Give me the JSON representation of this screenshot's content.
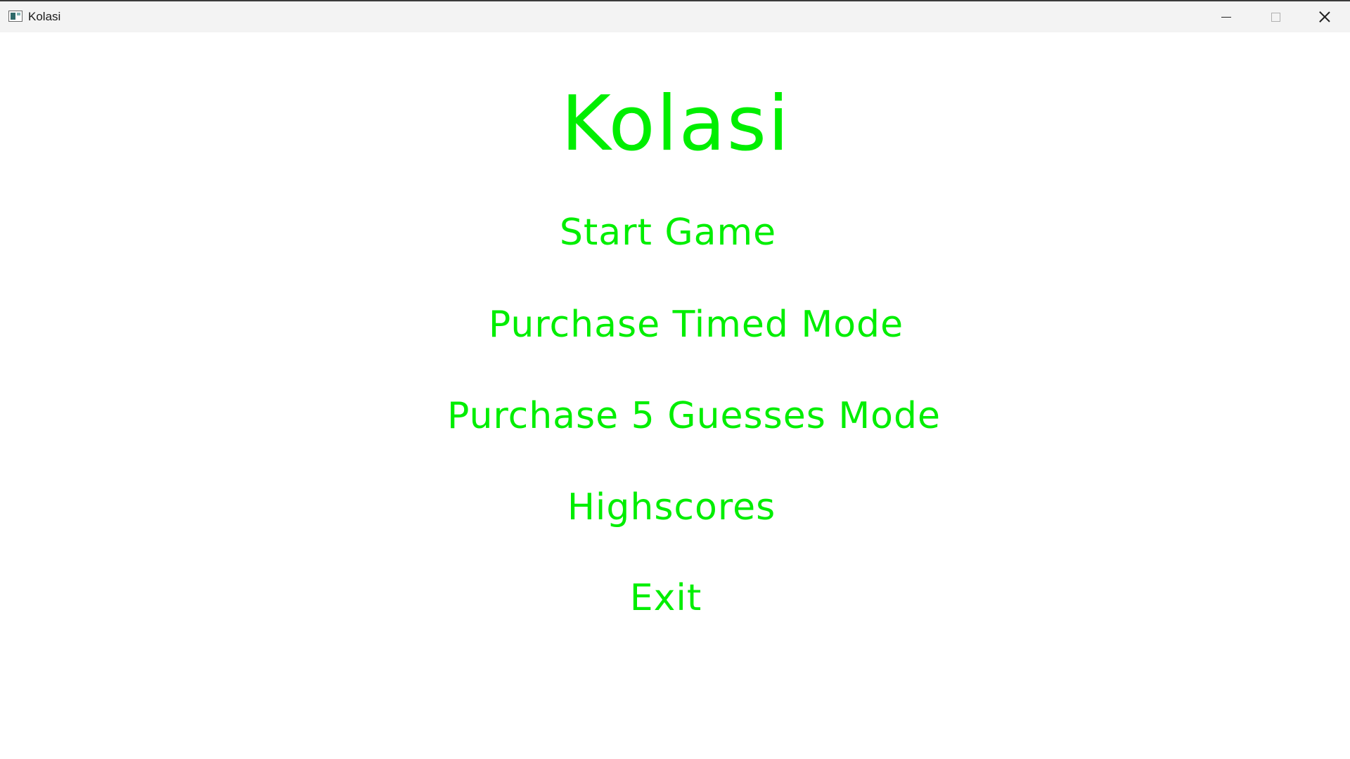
{
  "window": {
    "title": "Kolasi",
    "controls": {
      "minimize": "minimize-icon",
      "maximize": "maximize-icon",
      "close": "close-icon"
    }
  },
  "main": {
    "title": "Kolasi",
    "menu": [
      {
        "label": "Start Game"
      },
      {
        "label": "Purchase Timed Mode"
      },
      {
        "label": "Purchase 5 Guesses Mode"
      },
      {
        "label": "Highscores"
      },
      {
        "label": "Exit"
      }
    ]
  },
  "colors": {
    "accent": "#00ee00",
    "background": "#ffffff",
    "titlebar": "#f3f3f3"
  }
}
